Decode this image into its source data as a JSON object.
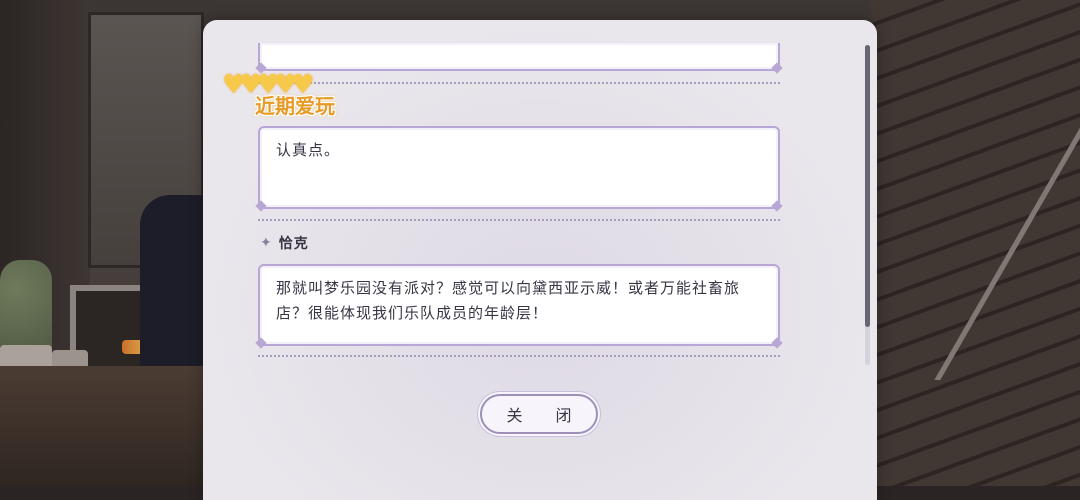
{
  "dialog": {
    "entries": [
      {
        "speaker": "近期爱玩",
        "text": "认真点。"
      },
      {
        "speaker": "恰克",
        "text": "那就叫梦乐园没有派对？感觉可以向黛西亚示威！或者万能社畜旅店？很能体现我们乐队成员的年龄层！"
      }
    ],
    "close_label": "关 闭"
  },
  "icons": {
    "speaker_marker": "sparkle-icon",
    "special_name_decoration": "hearts-icon"
  },
  "colors": {
    "panel_bg": "#e9e6ec",
    "box_border": "#b8a7d4",
    "special_name": "#e79a25",
    "hearts": "#f6c94b"
  }
}
